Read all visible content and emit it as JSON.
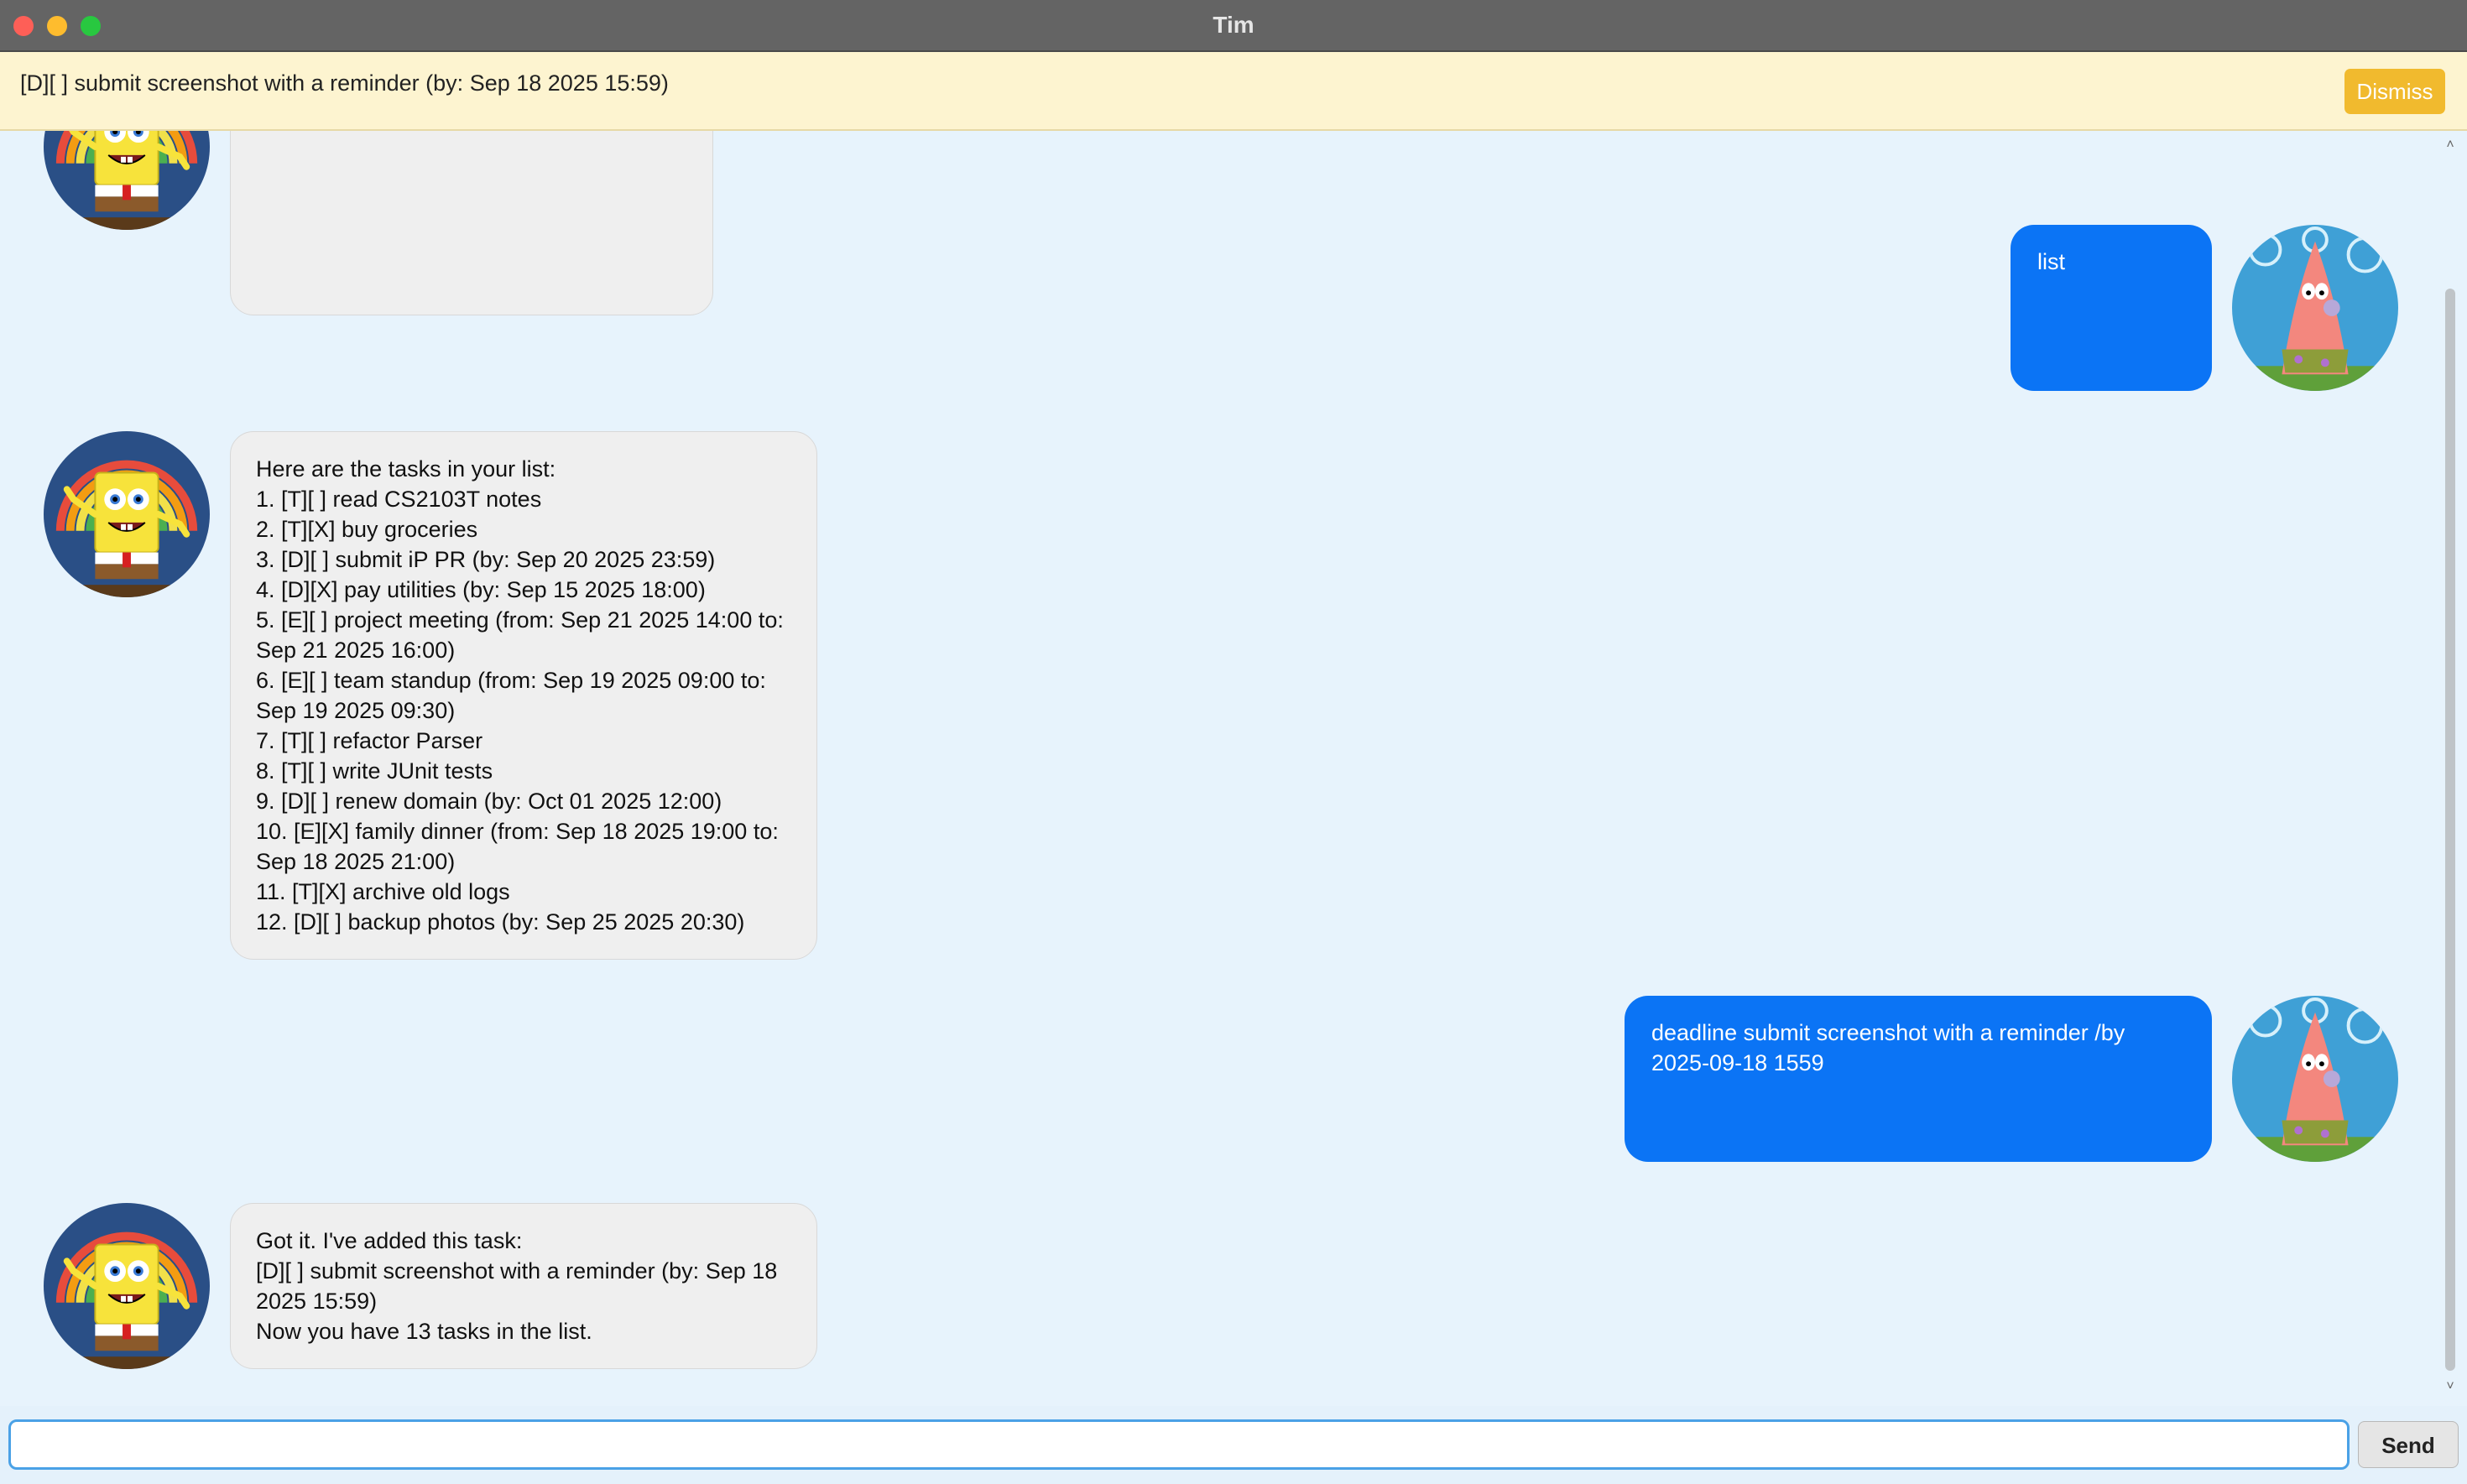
{
  "window": {
    "title": "Tim"
  },
  "reminder": {
    "text": "[D][ ] submit screenshot with a reminder (by: Sep 18 2025 15:59)",
    "dismiss_label": "Dismiss"
  },
  "messages": [
    {
      "sender": "bot",
      "text": ""
    },
    {
      "sender": "user",
      "text": "list"
    },
    {
      "sender": "bot",
      "text": "Here are the tasks in your list:\n1. [T][ ] read CS2103T notes\n2. [T][X] buy groceries\n3. [D][ ] submit iP PR (by: Sep 20 2025 23:59)\n4. [D][X] pay utilities (by: Sep 15 2025 18:00)\n5. [E][ ] project meeting (from: Sep 21 2025 14:00 to:\nSep 21 2025 16:00)\n6. [E][ ] team standup (from: Sep 19 2025 09:00 to:\nSep 19 2025 09:30)\n7. [T][ ] refactor Parser\n8. [T][ ] write JUnit tests\n9. [D][ ] renew domain (by: Oct 01 2025 12:00)\n10. [E][X] family dinner (from: Sep 18 2025 19:00 to:\nSep 18 2025 21:00)\n11. [T][X] archive old logs\n12. [D][ ] backup photos (by: Sep 25 2025 20:30)"
    },
    {
      "sender": "user",
      "text": "deadline submit screenshot with a reminder /by\n2025-09-18 1559"
    },
    {
      "sender": "bot",
      "text": "Got it. I've added this task:\n[D][ ] submit screenshot with a reminder (by: Sep 18\n2025 15:59)\nNow you have 13 tasks in the list."
    }
  ],
  "input": {
    "value": "",
    "placeholder": "",
    "send_label": "Send"
  },
  "colors": {
    "user_bubble": "#0b74f5",
    "bot_bubble": "#efefef",
    "reminder_bar": "#fdf4d0",
    "dismiss_button": "#f1ba2e",
    "chat_bg": "#e7f3fc"
  },
  "avatars": {
    "bot": "spongebob-avatar",
    "user": "patrick-avatar"
  }
}
